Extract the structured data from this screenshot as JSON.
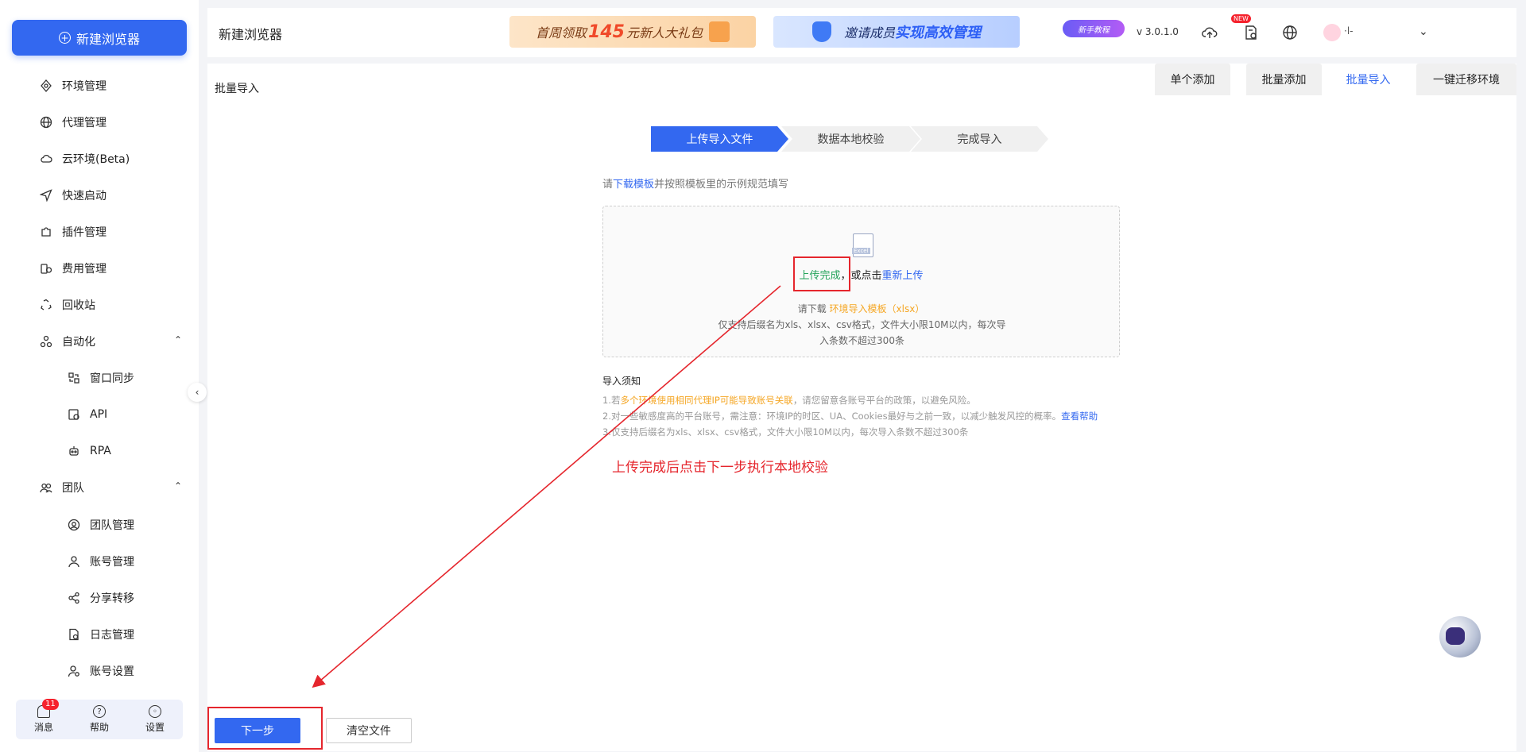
{
  "sidebar": {
    "new_button": "新建浏览器",
    "items": [
      {
        "label": "环境管理",
        "icon": "environment-icon"
      },
      {
        "label": "代理管理",
        "icon": "globe-icon"
      },
      {
        "label": "云环境(Beta)",
        "icon": "cloud-icon"
      },
      {
        "label": "快速启动",
        "icon": "send-icon"
      },
      {
        "label": "插件管理",
        "icon": "puzzle-icon"
      },
      {
        "label": "费用管理",
        "icon": "coins-icon"
      },
      {
        "label": "回收站",
        "icon": "recycle-icon"
      },
      {
        "label": "自动化",
        "icon": "automation-icon"
      },
      {
        "label": "窗口同步",
        "icon": "window-sync-icon"
      },
      {
        "label": "API",
        "icon": "api-icon"
      },
      {
        "label": "RPA",
        "icon": "robot-icon"
      },
      {
        "label": "团队",
        "icon": "team-icon"
      },
      {
        "label": "团队管理",
        "icon": "team-manage-icon"
      },
      {
        "label": "账号管理",
        "icon": "user-icon"
      },
      {
        "label": "分享转移",
        "icon": "share-icon"
      },
      {
        "label": "日志管理",
        "icon": "log-icon"
      },
      {
        "label": "账号设置",
        "icon": "user-settings-icon"
      }
    ],
    "bottom": {
      "messages": "消息",
      "messages_badge": "11",
      "help": "帮助",
      "settings": "设置"
    }
  },
  "header": {
    "title": "新建浏览器",
    "banner1": {
      "pre": "首周领取",
      "num": "145",
      "post": "元新人大礼包"
    },
    "banner2": {
      "pre": "邀请成员",
      "strong": "实现高效管理"
    },
    "tutorial": "新手教程",
    "version": "v 3.0.1.0",
    "new_tag": "NEW",
    "username": "·l-"
  },
  "main": {
    "section_title": "批量导入",
    "tabs": [
      "单个添加",
      "批量添加",
      "批量导入",
      "一键迁移环境"
    ],
    "active_tab": 2,
    "steps": [
      "上传导入文件",
      "数据本地校验",
      "完成导入"
    ],
    "hint": {
      "pre": "请",
      "link": "下载模板",
      "post": "并按照模板里的示例规范填写"
    },
    "dropzone": {
      "file_label": "Excel",
      "done": "上传完成",
      "middle": "，或点击",
      "reupload": "重新上传",
      "tpl_pre": "请下载 ",
      "tpl_link": "环境导入模板（xlsx）",
      "limit": "仅支持后缀名为xls、xlsx、csv格式，文件大小限10M以内，每次导入条数不超过300条"
    },
    "notes_title": "导入须知",
    "note1": {
      "pre": "1.若",
      "orange": "多个环境使用相同代理IP可能导致账号关联",
      "post": "，请您留意各账号平台的政策，以避免风险。"
    },
    "note2": {
      "text": "2.对一些敏感度高的平台账号，需注意：环境IP的时区、UA、Cookies最好与之前一致，以减少触发风控的概率。",
      "link": "查看帮助"
    },
    "note3": "3.仅支持后缀名为xls、xlsx、csv格式，文件大小限10M以内，每次导入条数不超过300条",
    "annotation": "上传完成后点击下一步执行本地校验"
  },
  "footer": {
    "next": "下一步",
    "clear": "清空文件"
  },
  "colors": {
    "primary": "#3368f0",
    "annotation_red": "#e5262d",
    "success_green": "#23a35a",
    "warning_orange": "#f5a623"
  }
}
